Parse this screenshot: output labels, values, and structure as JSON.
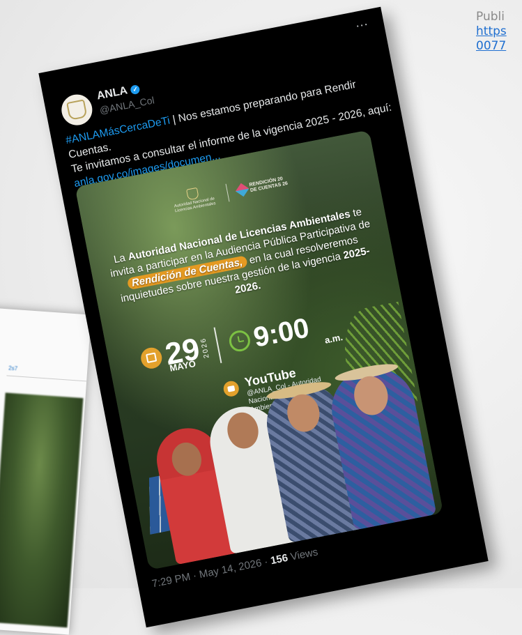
{
  "caption": {
    "prefix": "Publi",
    "link_line1": "https",
    "link_line2": "0077"
  },
  "background_card": {
    "link_fragment": "2s7"
  },
  "tweet": {
    "author_name": "ANLA",
    "handle": "@ANLA_Col",
    "more_label": "...",
    "hashtag": "#ANLAMásCercaDeTi",
    "text_line1": " | Nos estamos preparando para Rendir Cuentas.",
    "text_line2": "Te invitamos a consultar el informe de la vigencia 2025 - 2026, aquí:",
    "link": "anla.gov.co/images/documen...",
    "timestamp": "7:29 PM · May 14, 2026 · ",
    "views_count": "156",
    "views_label": " Views"
  },
  "poster": {
    "logo_left": "Autoridad Nacional de Licencias Ambientales",
    "logo_right_line1": "RENDICIÓN 20",
    "logo_right_line2": "DE CUENTAS 26",
    "invite_pre": "La ",
    "invite_bold1": "Autoridad Nacional de Licencias Ambientales",
    "invite_mid": " te invita a participar en la Audiencia Pública Participativa de ",
    "invite_highlight": "Rendición de Cuentas,",
    "invite_post": " en la cual resolveremos inquietudes sobre nuestra gestión de la vigencia ",
    "invite_bold2": "2025-2026.",
    "day": "29",
    "year": "2026",
    "month": "MAYO",
    "time": "9:00",
    "ampm": "a.m.",
    "platform": "YouTube",
    "channel": "@ANLA_Col - Autoridad Nacional de Licencias Ambientales"
  },
  "colors": {
    "accent_orange": "#e59a22",
    "accent_green": "#7cc143",
    "twitter_blue": "#1d9bf0"
  }
}
